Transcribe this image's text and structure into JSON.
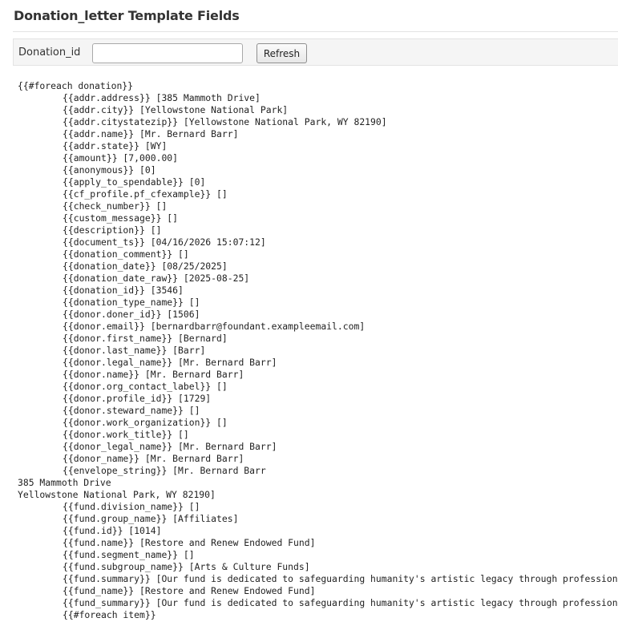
{
  "page": {
    "title": "Donation_letter Template Fields"
  },
  "form": {
    "donation_id_label": "Donation_id",
    "donation_id_value": "",
    "donation_id_placeholder": "",
    "refresh_label": "Refresh"
  },
  "output": {
    "lines": [
      {
        "indent": 0,
        "text": "{{#foreach donation}}"
      },
      {
        "indent": 1,
        "text": "{{addr.address}} [385 Mammoth Drive]"
      },
      {
        "indent": 1,
        "text": "{{addr.city}} [Yellowstone National Park]"
      },
      {
        "indent": 1,
        "text": "{{addr.citystatezip}} [Yellowstone National Park, WY 82190]"
      },
      {
        "indent": 1,
        "text": "{{addr.name}} [Mr. Bernard Barr]"
      },
      {
        "indent": 1,
        "text": "{{addr.state}} [WY]"
      },
      {
        "indent": 1,
        "text": "{{amount}} [7,000.00]"
      },
      {
        "indent": 1,
        "text": "{{anonymous}} [0]"
      },
      {
        "indent": 1,
        "text": "{{apply_to_spendable}} [0]"
      },
      {
        "indent": 1,
        "text": "{{cf_profile.pf_cfexample}} []"
      },
      {
        "indent": 1,
        "text": "{{check_number}} []"
      },
      {
        "indent": 1,
        "text": "{{custom_message}} []"
      },
      {
        "indent": 1,
        "text": "{{description}} []"
      },
      {
        "indent": 1,
        "text": "{{document_ts}} [04/16/2026 15:07:12]"
      },
      {
        "indent": 1,
        "text": "{{donation_comment}} []"
      },
      {
        "indent": 1,
        "text": "{{donation_date}} [08/25/2025]"
      },
      {
        "indent": 1,
        "text": "{{donation_date_raw}} [2025-08-25]"
      },
      {
        "indent": 1,
        "text": "{{donation_id}} [3546]"
      },
      {
        "indent": 1,
        "text": "{{donation_type_name}} []"
      },
      {
        "indent": 1,
        "text": "{{donor.doner_id}} [1506]"
      },
      {
        "indent": 1,
        "text": "{{donor.email}} [bernardbarr@foundant.exampleemail.com]"
      },
      {
        "indent": 1,
        "text": "{{donor.first_name}} [Bernard]"
      },
      {
        "indent": 1,
        "text": "{{donor.last_name}} [Barr]"
      },
      {
        "indent": 1,
        "text": "{{donor.legal_name}} [Mr. Bernard Barr]"
      },
      {
        "indent": 1,
        "text": "{{donor.name}} [Mr. Bernard Barr]"
      },
      {
        "indent": 1,
        "text": "{{donor.org_contact_label}} []"
      },
      {
        "indent": 1,
        "text": "{{donor.profile_id}} [1729]"
      },
      {
        "indent": 1,
        "text": "{{donor.steward_name}} []"
      },
      {
        "indent": 1,
        "text": "{{donor.work_organization}} []"
      },
      {
        "indent": 1,
        "text": "{{donor.work_title}} []"
      },
      {
        "indent": 1,
        "text": "{{donor_legal_name}} [Mr. Bernard Barr]"
      },
      {
        "indent": 1,
        "text": "{{donor_name}} [Mr. Bernard Barr]"
      },
      {
        "indent": 1,
        "text": "{{envelope_string}} [Mr. Bernard Barr"
      },
      {
        "indent": 0,
        "text": "385 Mammoth Drive"
      },
      {
        "indent": 0,
        "text": "Yellowstone National Park, WY 82190]"
      },
      {
        "indent": 1,
        "text": "{{fund.division_name}} []"
      },
      {
        "indent": 1,
        "text": "{{fund.group_name}} [Affiliates]"
      },
      {
        "indent": 1,
        "text": "{{fund.id}} [1014]"
      },
      {
        "indent": 1,
        "text": "{{fund.name}} [Restore and Renew Endowed Fund]"
      },
      {
        "indent": 1,
        "text": "{{fund.segment_name}} []"
      },
      {
        "indent": 1,
        "text": "{{fund.subgroup_name}} [Arts & Culture Funds]"
      },
      {
        "indent": 1,
        "text": "{{fund.summary}} [Our fund is dedicated to safeguarding humanity's artistic legacy through professional"
      },
      {
        "indent": 1,
        "text": "{{fund_name}} [Restore and Renew Endowed Fund]"
      },
      {
        "indent": 1,
        "text": "{{fund_summary}} [Our fund is dedicated to safeguarding humanity's artistic legacy through professional"
      },
      {
        "indent": 1,
        "text": "{{#foreach item}}"
      }
    ]
  }
}
